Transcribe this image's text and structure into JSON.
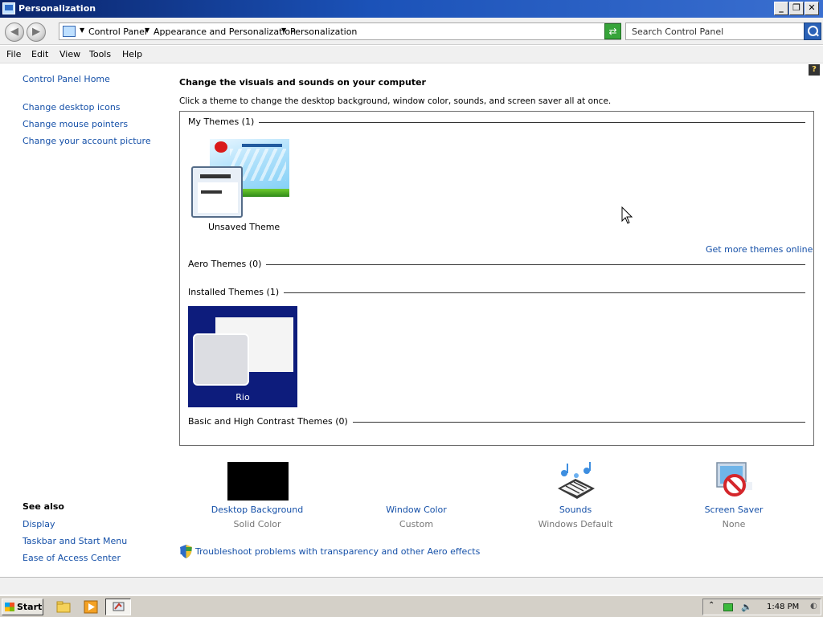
{
  "window": {
    "title": "Personalization"
  },
  "address": {
    "crumbs": [
      "Control Panel",
      "Appearance and Personalization",
      "Personalization"
    ],
    "search_placeholder": "Search Control Panel"
  },
  "menu": [
    "File",
    "Edit",
    "View",
    "Tools",
    "Help"
  ],
  "left_pane": {
    "links": [
      "Control Panel Home",
      "Change desktop icons",
      "Change mouse pointers",
      "Change your account picture"
    ],
    "see_also_title": "See also",
    "see_also": [
      "Display",
      "Taskbar and Start Menu",
      "Ease of Access Center"
    ]
  },
  "main": {
    "heading": "Change the visuals and sounds on your computer",
    "subtitle": "Click a theme to change the desktop background, window color, sounds, and screen saver all at once.",
    "groups": {
      "my_themes": "My Themes (1)",
      "aero_themes": "Aero Themes (0)",
      "installed_themes": "Installed Themes (1)",
      "basic_themes": "Basic and High Contrast Themes (0)"
    },
    "themes": {
      "unsaved": "Unsaved Theme",
      "rio": "Rio"
    },
    "more_themes_link": "Get more themes online"
  },
  "options": [
    {
      "name": "Desktop Background",
      "value": "Solid Color",
      "swatch": "#000000"
    },
    {
      "name": "Window Color",
      "value": "Custom"
    },
    {
      "name": "Sounds",
      "value": "Windows Default"
    },
    {
      "name": "Screen Saver",
      "value": "None"
    }
  ],
  "troubleshoot": "Troubleshoot problems with transparency and other Aero effects",
  "taskbar": {
    "start_label": "Start",
    "clock": "1:48 PM"
  },
  "colors": {
    "title_bar": "#0a246a",
    "link": "#1550a8",
    "rio_bg": "#0d1c7c"
  }
}
